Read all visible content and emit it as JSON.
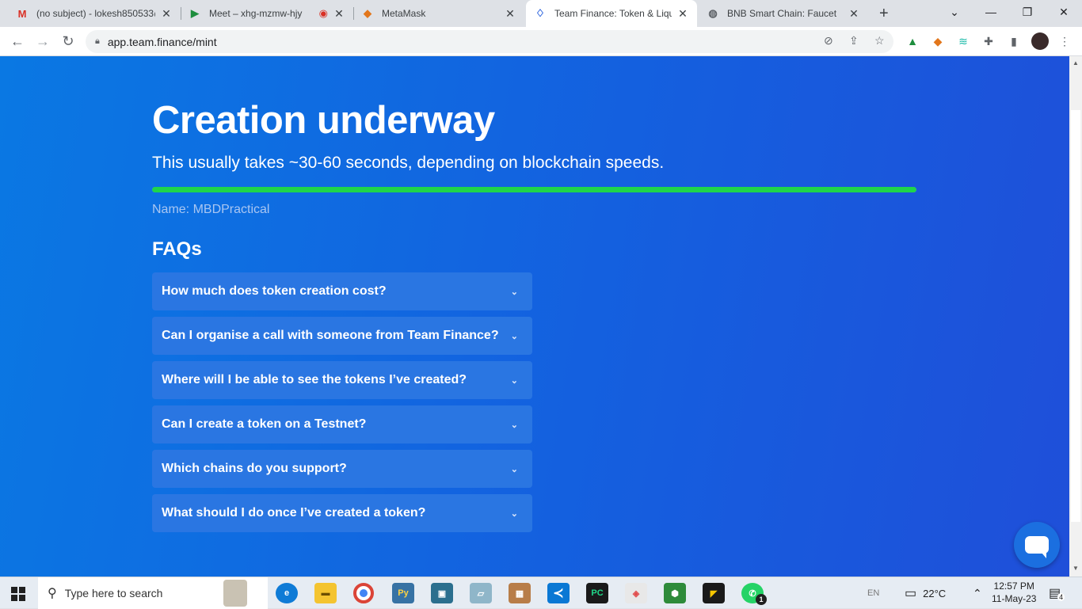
{
  "browser": {
    "tabs": [
      {
        "title": "(no subject) - lokesh850533@",
        "favicon": "gmail-icon",
        "active": false
      },
      {
        "title": "Meet – xhg-mzmw-hjy",
        "favicon": "meet-icon",
        "active": false
      },
      {
        "title": "MetaMask",
        "favicon": "metamask-icon",
        "active": false
      },
      {
        "title": "Team Finance: Token & Liqui",
        "favicon": "teamfinance-icon",
        "active": true
      },
      {
        "title": "BNB Smart Chain: Faucet",
        "favicon": "globe-icon",
        "active": false
      }
    ],
    "url": "app.team.finance/mint"
  },
  "page": {
    "heading": "Creation underway",
    "subtitle": "This usually takes ~30-60 seconds, depending on blockchain speeds.",
    "progress": 1.0,
    "progress_color": "#1fd54a",
    "name_line": "Name: MBDPractical",
    "faq_heading": "FAQs",
    "faqs": [
      "How much does token creation cost?",
      "Can I organise a call with someone from Team Finance?",
      "Where will I be able to see the tokens I’ve created?",
      "Can I create a token on a Testnet?",
      "Which chains do you support?",
      "What should I do once I’ve created a token?"
    ]
  },
  "taskbar": {
    "search_placeholder": "Type here to search",
    "language": "EN",
    "temperature": "22°C",
    "time": "12:57 PM",
    "date": "11-May-23",
    "notification_count": "4",
    "whatsapp_badge": "1"
  }
}
